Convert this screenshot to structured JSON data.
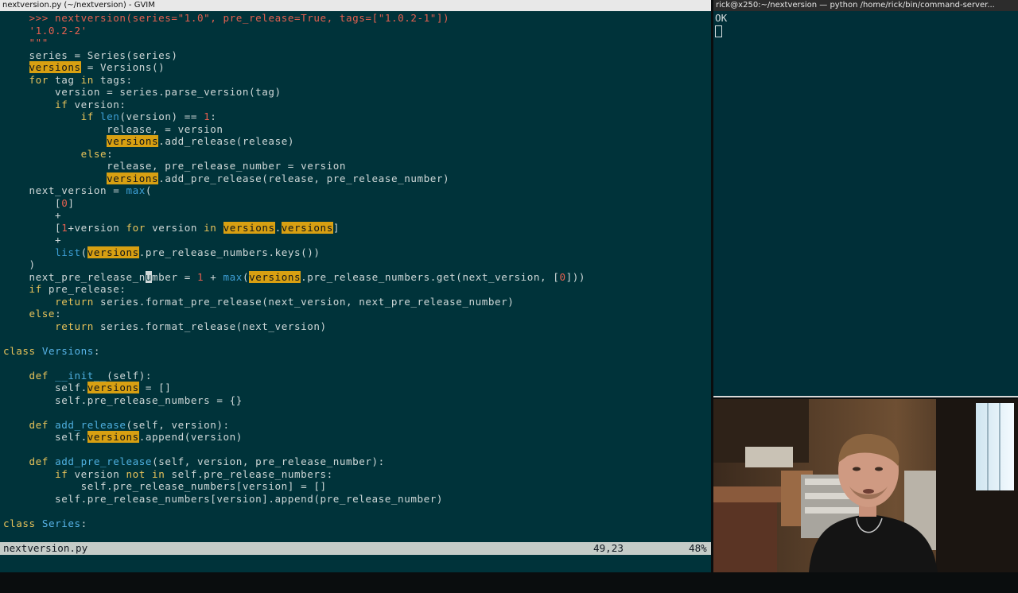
{
  "windows": {
    "gvim_title": "nextversion.py (~/nextversion) - GVIM",
    "terminal_title": "rick@x250:~/nextversion — python /home/rick/bin/command-server..."
  },
  "editor": {
    "lines": [
      [
        [
          "    ",
          ""
        ],
        [
          ">>> nextversion(series=",
          "str"
        ],
        [
          "\"1.0\"",
          "str"
        ],
        [
          ", pre_release=",
          "str"
        ],
        [
          "True",
          "str"
        ],
        [
          ", tags=[",
          "str"
        ],
        [
          "\"1.0.2-1\"",
          "str"
        ],
        [
          "])",
          "str"
        ]
      ],
      [
        [
          "    ",
          ""
        ],
        [
          "'1.0.2-2'",
          "str"
        ]
      ],
      [
        [
          "    ",
          ""
        ],
        [
          "\"\"\"",
          "str"
        ]
      ],
      [
        [
          "    series = Series(series)",
          ""
        ]
      ],
      [
        [
          "    ",
          ""
        ],
        [
          "versions",
          "hl"
        ],
        [
          " = Versions()",
          ""
        ]
      ],
      [
        [
          "    ",
          ""
        ],
        [
          "for",
          "kw"
        ],
        [
          " tag ",
          ""
        ],
        [
          "in",
          "kw"
        ],
        [
          " tags:",
          ""
        ]
      ],
      [
        [
          "        version = series.parse_version(tag)",
          ""
        ]
      ],
      [
        [
          "        ",
          ""
        ],
        [
          "if",
          "kw"
        ],
        [
          " version:",
          ""
        ]
      ],
      [
        [
          "            ",
          ""
        ],
        [
          "if",
          "kw"
        ],
        [
          " ",
          ""
        ],
        [
          "len",
          "bi"
        ],
        [
          "(version) == ",
          ""
        ],
        [
          "1",
          "num"
        ],
        [
          ":",
          ""
        ]
      ],
      [
        [
          "                release, = version",
          ""
        ]
      ],
      [
        [
          "                ",
          ""
        ],
        [
          "versions",
          "hl"
        ],
        [
          ".add_release(release)",
          ""
        ]
      ],
      [
        [
          "            ",
          ""
        ],
        [
          "else",
          "kw"
        ],
        [
          ":",
          ""
        ]
      ],
      [
        [
          "                release, pre_release_number = version",
          ""
        ]
      ],
      [
        [
          "                ",
          ""
        ],
        [
          "versions",
          "hl"
        ],
        [
          ".add_pre_release(release, pre_release_number)",
          ""
        ]
      ],
      [
        [
          "    next_version = ",
          ""
        ],
        [
          "max",
          "bi"
        ],
        [
          "(",
          ""
        ]
      ],
      [
        [
          "        [",
          ""
        ],
        [
          "0",
          "num"
        ],
        [
          "]",
          ""
        ]
      ],
      [
        [
          "        +",
          ""
        ]
      ],
      [
        [
          "        [",
          ""
        ],
        [
          "1",
          "num"
        ],
        [
          "+version ",
          ""
        ],
        [
          "for",
          "kw"
        ],
        [
          " version ",
          ""
        ],
        [
          "in",
          "kw"
        ],
        [
          " ",
          ""
        ],
        [
          "versions",
          "hl"
        ],
        [
          ".",
          ""
        ],
        [
          "versions",
          "hl"
        ],
        [
          "]",
          ""
        ]
      ],
      [
        [
          "        +",
          ""
        ]
      ],
      [
        [
          "        ",
          ""
        ],
        [
          "list",
          "bi"
        ],
        [
          "(",
          ""
        ],
        [
          "versions",
          "hl"
        ],
        [
          ".pre_release_numbers.keys())",
          ""
        ]
      ],
      [
        [
          "    )",
          ""
        ]
      ],
      [
        [
          "    next_pre_release_n",
          ""
        ],
        [
          "u",
          "cur"
        ],
        [
          "mber = ",
          ""
        ],
        [
          "1",
          "num"
        ],
        [
          " + ",
          ""
        ],
        [
          "max",
          "bi"
        ],
        [
          "(",
          ""
        ],
        [
          "versions",
          "hl"
        ],
        [
          ".pre_release_numbers.get(next_version, [",
          ""
        ],
        [
          "0",
          "num"
        ],
        [
          "]))",
          ""
        ]
      ],
      [
        [
          "    ",
          ""
        ],
        [
          "if",
          "kw"
        ],
        [
          " pre_release:",
          ""
        ]
      ],
      [
        [
          "        ",
          ""
        ],
        [
          "return",
          "kw"
        ],
        [
          " series.format_pre_release(next_version, next_pre_release_number)",
          ""
        ]
      ],
      [
        [
          "    ",
          ""
        ],
        [
          "else",
          "kw"
        ],
        [
          ":",
          ""
        ]
      ],
      [
        [
          "        ",
          ""
        ],
        [
          "return",
          "kw"
        ],
        [
          " series.format_release(next_version)",
          ""
        ]
      ],
      [
        [
          "",
          ""
        ]
      ],
      [
        [
          "class",
          "kw"
        ],
        [
          " ",
          ""
        ],
        [
          "Versions",
          "cls"
        ],
        [
          ":",
          ""
        ]
      ],
      [
        [
          "",
          ""
        ]
      ],
      [
        [
          "    ",
          ""
        ],
        [
          "def",
          "kw"
        ],
        [
          " ",
          ""
        ],
        [
          "__init__",
          "fn"
        ],
        [
          "(self):",
          ""
        ]
      ],
      [
        [
          "        self.",
          ""
        ],
        [
          "versions",
          "hl"
        ],
        [
          " = []",
          ""
        ]
      ],
      [
        [
          "        self.pre_release_numbers = {}",
          ""
        ]
      ],
      [
        [
          "",
          ""
        ]
      ],
      [
        [
          "    ",
          ""
        ],
        [
          "def",
          "kw"
        ],
        [
          " ",
          ""
        ],
        [
          "add_release",
          "fn"
        ],
        [
          "(self, version):",
          ""
        ]
      ],
      [
        [
          "        self.",
          ""
        ],
        [
          "versions",
          "hl"
        ],
        [
          ".append(version)",
          ""
        ]
      ],
      [
        [
          "",
          ""
        ]
      ],
      [
        [
          "    ",
          ""
        ],
        [
          "def",
          "kw"
        ],
        [
          " ",
          ""
        ],
        [
          "add_pre_release",
          "fn"
        ],
        [
          "(self, version, pre_release_number):",
          ""
        ]
      ],
      [
        [
          "        ",
          ""
        ],
        [
          "if",
          "kw"
        ],
        [
          " version ",
          ""
        ],
        [
          "not in",
          "kw"
        ],
        [
          " self.pre_release_numbers:",
          ""
        ]
      ],
      [
        [
          "            self.pre_release_numbers[version] = []",
          ""
        ]
      ],
      [
        [
          "        self.pre_release_numbers[version].append(pre_release_number)",
          ""
        ]
      ],
      [
        [
          "",
          ""
        ]
      ],
      [
        [
          "class",
          "kw"
        ],
        [
          " ",
          ""
        ],
        [
          "Series",
          "cls"
        ],
        [
          ":",
          ""
        ]
      ]
    ]
  },
  "statusbar": {
    "filename": "nextversion.py",
    "position": "49,23",
    "percent": "48%"
  },
  "terminal": {
    "output": "OK"
  },
  "colors": {
    "editor_bg": "#00333a",
    "search_highlight": "#d8a012",
    "keyword": "#e8c35a",
    "function": "#4fb0e0",
    "string": "#e56050",
    "statusbar_bg": "#c5ccc8"
  }
}
